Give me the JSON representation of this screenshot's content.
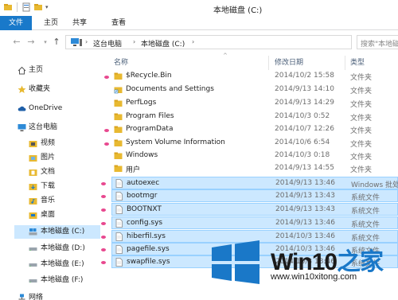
{
  "window": {
    "title": "本地磁盘 (C:)"
  },
  "ribbon": {
    "tabs": [
      "文件",
      "主页",
      "共享",
      "查看"
    ]
  },
  "address": {
    "crumbs": [
      "这台电脑",
      "本地磁盘 (C:)"
    ],
    "search_placeholder": "搜索\"本地磁盘..."
  },
  "nav": {
    "items": [
      {
        "label": "主页",
        "icon": "home-icon"
      },
      {
        "label": "收藏夹",
        "icon": "star-icon"
      },
      {
        "label": "OneDrive",
        "icon": "cloud-icon"
      },
      {
        "label": "这台电脑",
        "icon": "computer-icon"
      },
      {
        "label": "视频",
        "icon": "video-folder-icon"
      },
      {
        "label": "图片",
        "icon": "pictures-folder-icon"
      },
      {
        "label": "文档",
        "icon": "documents-folder-icon"
      },
      {
        "label": "下载",
        "icon": "downloads-folder-icon"
      },
      {
        "label": "音乐",
        "icon": "music-folder-icon"
      },
      {
        "label": "桌面",
        "icon": "desktop-folder-icon"
      },
      {
        "label": "本地磁盘 (C:)",
        "icon": "drive-c-icon"
      },
      {
        "label": "本地磁盘 (D:)",
        "icon": "drive-icon"
      },
      {
        "label": "本地磁盘 (E:)",
        "icon": "drive-icon"
      },
      {
        "label": "本地磁盘 (F:)",
        "icon": "drive-icon"
      },
      {
        "label": "网络",
        "icon": "network-icon"
      }
    ]
  },
  "columns": {
    "name": "名称",
    "date": "修改日期",
    "type": "类型"
  },
  "files": [
    {
      "name": "$Recycle.Bin",
      "date": "2014/10/2 15:58",
      "type": "文件夹",
      "kind": "folder",
      "selected": false
    },
    {
      "name": "Documents and Settings",
      "date": "2014/9/13 14:10",
      "type": "文件夹",
      "kind": "link",
      "selected": false
    },
    {
      "name": "PerfLogs",
      "date": "2014/9/13 14:29",
      "type": "文件夹",
      "kind": "folder",
      "selected": false
    },
    {
      "name": "Program Files",
      "date": "2014/10/3 0:52",
      "type": "文件夹",
      "kind": "folder",
      "selected": false
    },
    {
      "name": "ProgramData",
      "date": "2014/10/7 12:26",
      "type": "文件夹",
      "kind": "folder",
      "selected": false
    },
    {
      "name": "System Volume Information",
      "date": "2014/10/6 6:54",
      "type": "文件夹",
      "kind": "folder",
      "selected": false
    },
    {
      "name": "Windows",
      "date": "2014/10/3 0:18",
      "type": "文件夹",
      "kind": "folder",
      "selected": false
    },
    {
      "name": "用户",
      "date": "2014/9/13 14:55",
      "type": "文件夹",
      "kind": "folder",
      "selected": false
    },
    {
      "name": "autoexec",
      "date": "2014/9/13 13:46",
      "type": "Windows 批处",
      "kind": "file",
      "selected": true
    },
    {
      "name": "bootmgr",
      "date": "2014/9/13 13:43",
      "type": "系统文件",
      "kind": "file",
      "selected": true
    },
    {
      "name": "BOOTNXT",
      "date": "2014/9/13 13:43",
      "type": "系统文件",
      "kind": "file",
      "selected": true
    },
    {
      "name": "config.sys",
      "date": "2014/9/13 13:46",
      "type": "系统文件",
      "kind": "file",
      "selected": true
    },
    {
      "name": "hiberfil.sys",
      "date": "2014/10/3 13:46",
      "type": "系统文件",
      "kind": "file",
      "selected": true
    },
    {
      "name": "pagefile.sys",
      "date": "2014/10/3 13:46",
      "type": "系统文件",
      "kind": "file",
      "selected": true
    },
    {
      "name": "swapfile.sys",
      "date": "2014/10/3 13:46",
      "type": "系统文件",
      "kind": "file",
      "selected": true
    }
  ],
  "watermark": {
    "title_main": "Win10",
    "title_accent": "之家",
    "url": "www.win10xitong.com"
  },
  "colors": {
    "accent": "#1979ca",
    "selection": "#cce8ff",
    "mark": "#e8488f",
    "folder": "#e8b931"
  }
}
